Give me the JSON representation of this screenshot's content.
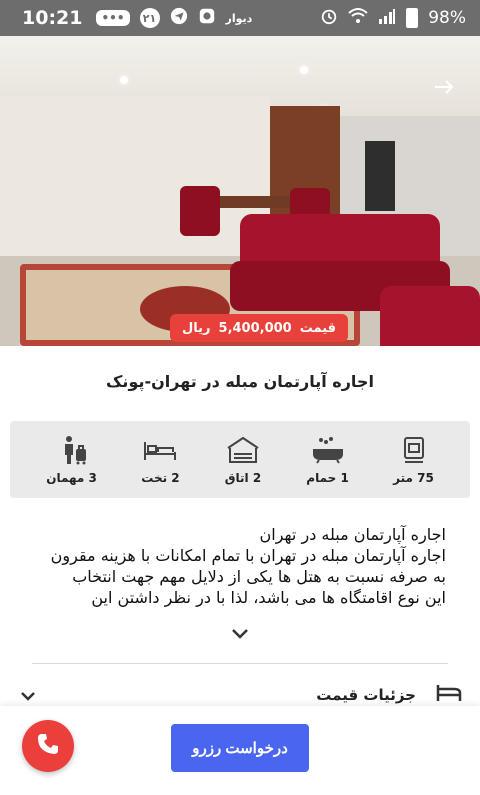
{
  "status_bar": {
    "time": "10:21",
    "chat_badge": "•••",
    "number_badge": "۲۱",
    "app_label": "دیوار",
    "battery": "98%",
    "icons": [
      "chat-icon",
      "number-badge-icon",
      "send-icon",
      "emblem-icon",
      "alarm-icon",
      "wifi-icon",
      "signal-icon",
      "battery-icon"
    ]
  },
  "hero": {
    "price_label": "قیمت",
    "price_value": "5,400,000",
    "price_unit": "ریال",
    "share_icon": "arrow-right-icon"
  },
  "listing": {
    "title": "اجاره آپارتمان مبله در تهران-پونک"
  },
  "features": [
    {
      "icon": "size-icon",
      "label": "75 متر"
    },
    {
      "icon": "bath-icon",
      "label": "1 حمام"
    },
    {
      "icon": "room-icon",
      "label": "2 اتاق"
    },
    {
      "icon": "bed-icon",
      "label": "2 تخت"
    },
    {
      "icon": "guest-icon",
      "label": "3 مهمان"
    }
  ],
  "description": {
    "lines": [
      "اجاره آپارتمان مبله در تهران",
      "اجاره آپارتمان مبله در تهران با تمام امکانات با هزینه مقرون",
      "به صرفه نسبت به هتل ها یکی از دلایل مهم جهت انتخاب",
      "این نوع اقامتگاه ها می باشد، لذا با در نظر داشتن این"
    ],
    "expand_icon": "chevron-down-icon"
  },
  "price_details": {
    "label": "جزئیات قیمت",
    "icon": "bed-outline-icon"
  },
  "bottom": {
    "reserve_label": "درخواست رزرو",
    "call_icon": "phone-icon"
  },
  "colors": {
    "accent_red": "#e8403b",
    "accent_blue": "#4a65f0",
    "status_bar": "#6d6d6d"
  }
}
